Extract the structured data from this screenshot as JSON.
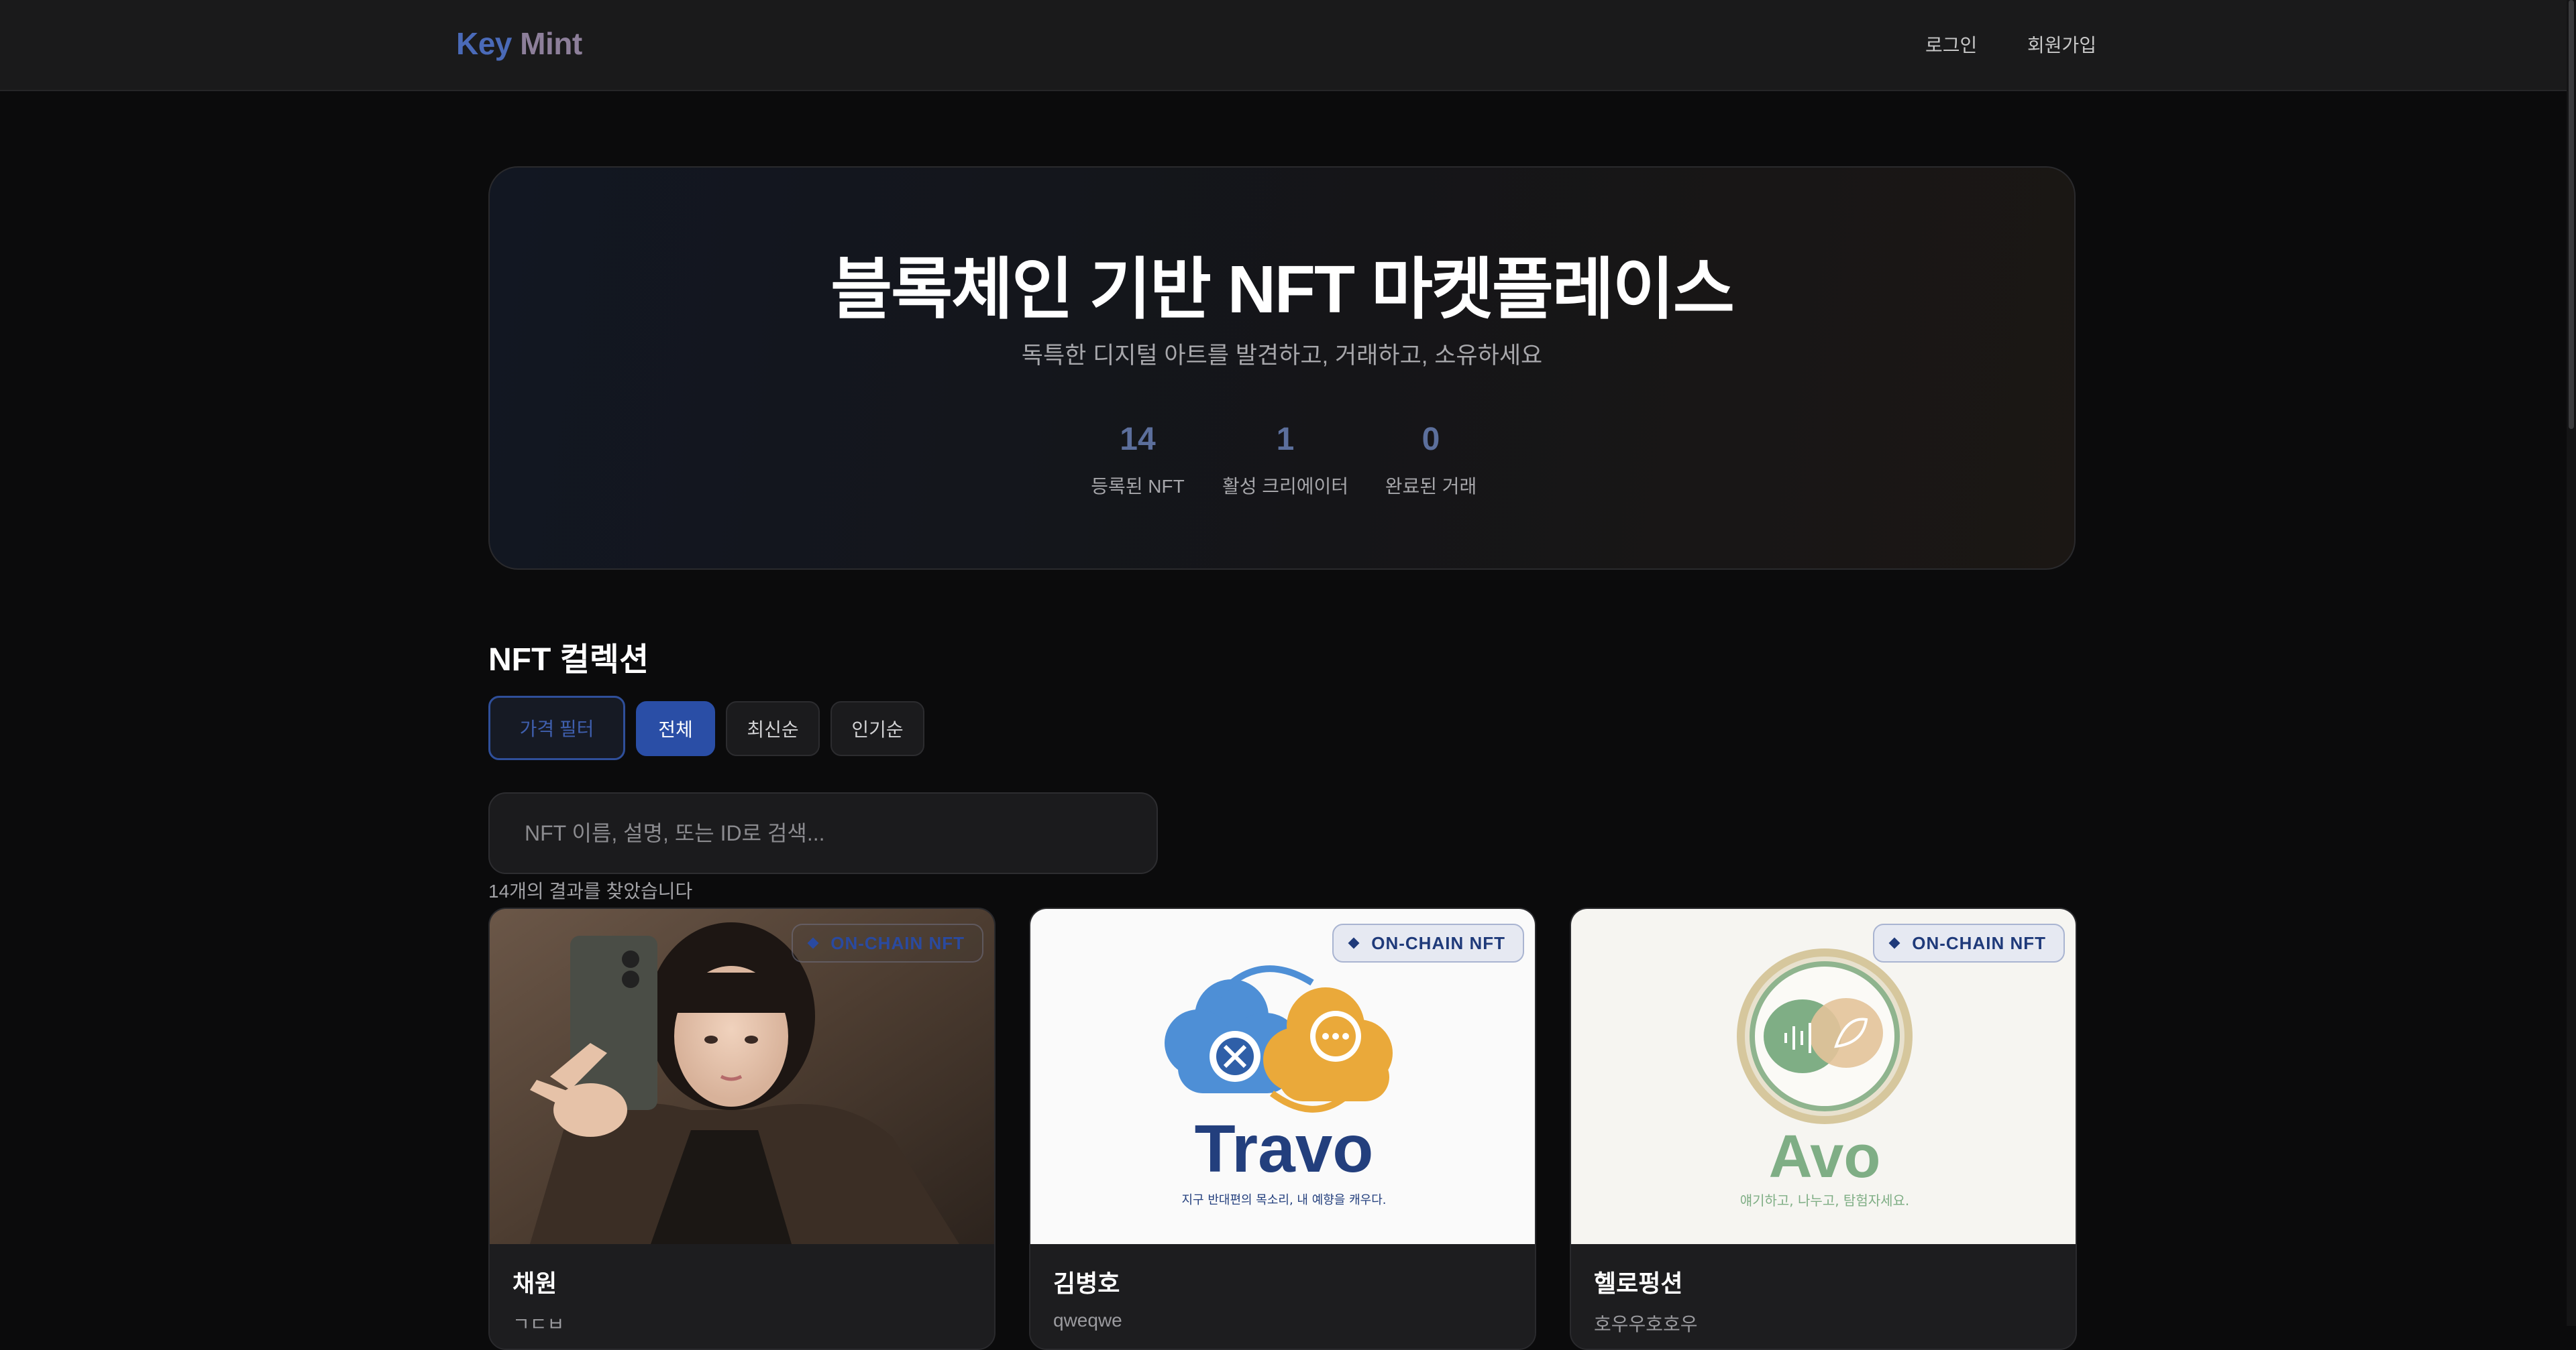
{
  "header": {
    "logo_word1": "Key",
    "logo_word2": "Mint",
    "nav": {
      "login": "로그인",
      "signup": "회원가입"
    }
  },
  "hero": {
    "title": "블록체인 기반 NFT 마켓플레이스",
    "subtitle": "독특한 디지털 아트를 발견하고, 거래하고, 소유하세요",
    "stats": [
      {
        "value": "14",
        "label": "등록된 NFT"
      },
      {
        "value": "1",
        "label": "활성 크리에이터"
      },
      {
        "value": "0",
        "label": "완료된 거래"
      }
    ]
  },
  "collection": {
    "title": "NFT 컬렉션",
    "filters": {
      "price": "가격 필터",
      "all": "전체",
      "newest": "최신순",
      "popular": "인기순"
    },
    "search": {
      "placeholder": "NFT 이름, 설명, 또는 ID로 검색..."
    },
    "result_count": "14개의 결과를 찾았습니다",
    "badge_label": "ON-CHAIN NFT",
    "cards": [
      {
        "name": "채원",
        "description": "ㄱㄷㅂ",
        "image_icon": "portrait-photo"
      },
      {
        "name": "김병호",
        "description": "qweqwe",
        "image_icon": "travo-logo",
        "logo_text": "Travo",
        "logo_tagline": "지구 반대편의 목소리, 내 예향을 캐우다."
      },
      {
        "name": "헬로펑션",
        "description": "호우우호호우",
        "image_icon": "avo-logo",
        "logo_text": "Avo",
        "logo_tagline": "얘기하고, 나누고, 탐험자세요."
      }
    ]
  },
  "colors": {
    "accent": "#2a4ea6",
    "logo_blue": "#4a6ab8",
    "stat_number": "#5c6f9c",
    "background": "#0b0b0c"
  }
}
